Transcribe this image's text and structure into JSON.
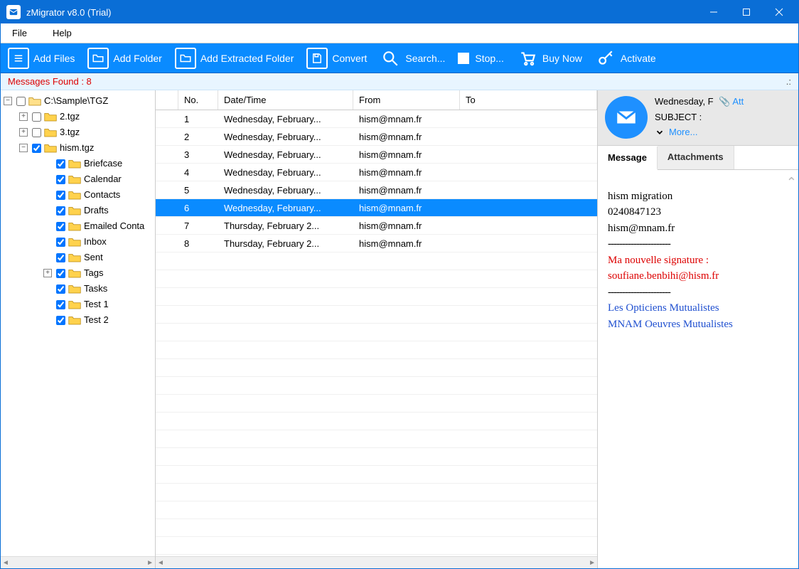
{
  "app": {
    "title": "zMigrator v8.0 (Trial)"
  },
  "menu": {
    "file": "File",
    "help": "Help"
  },
  "toolbar": {
    "add_files": "Add Files",
    "add_folder": "Add Folder",
    "add_extracted": "Add Extracted Folder",
    "convert": "Convert",
    "search": "Search...",
    "stop": "Stop...",
    "buy": "Buy Now",
    "activate": "Activate"
  },
  "status": {
    "label": "Messages Found : 8"
  },
  "tree": {
    "root": "C:\\Sample\\TGZ",
    "nodes": [
      {
        "label": "2.tgz"
      },
      {
        "label": "3.tgz"
      },
      {
        "label": "hism.tgz",
        "children": [
          "Briefcase",
          "Calendar",
          "Contacts",
          "Drafts",
          "Emailed Conta",
          "Inbox",
          "Sent",
          "Tags",
          "Tasks",
          "Test 1",
          "Test 2"
        ]
      }
    ]
  },
  "grid": {
    "headers": {
      "no": "No.",
      "dt": "Date/Time",
      "from": "From",
      "to": "To"
    },
    "rows": [
      {
        "no": "1",
        "dt": "Wednesday, February...",
        "from": "hism@mnam.fr",
        "to": ""
      },
      {
        "no": "2",
        "dt": "Wednesday, February...",
        "from": "hism@mnam.fr",
        "to": ""
      },
      {
        "no": "3",
        "dt": "Wednesday, February...",
        "from": "hism@mnam.fr",
        "to": ""
      },
      {
        "no": "4",
        "dt": "Wednesday, February...",
        "from": "hism@mnam.fr",
        "to": ""
      },
      {
        "no": "5",
        "dt": "Wednesday, February...",
        "from": "hism@mnam.fr",
        "to": ""
      },
      {
        "no": "6",
        "dt": "Wednesday, February...",
        "from": "hism@mnam.fr",
        "to": "",
        "selected": true
      },
      {
        "no": "7",
        "dt": "Thursday, February 2...",
        "from": "hism@mnam.fr",
        "to": ""
      },
      {
        "no": "8",
        "dt": "Thursday, February 2...",
        "from": "hism@mnam.fr",
        "to": ""
      }
    ]
  },
  "preview": {
    "date": "Wednesday, F",
    "att_label": "Att",
    "subject_label": "SUBJECT :",
    "more": "More...",
    "tabs": {
      "message": "Message",
      "attachments": "Attachments"
    },
    "body": {
      "line1": "hism migration",
      "line2": "0240847123",
      "line3": "hism@mnam.fr",
      "dash": "----------------------",
      "sig1": "Ma nouvelle signature :",
      "sig2": "soufiane.benbihi@hism.fr",
      "org1": "Les Opticiens Mutualistes",
      "org2": "MNAM Oeuvres Mutualistes"
    }
  }
}
